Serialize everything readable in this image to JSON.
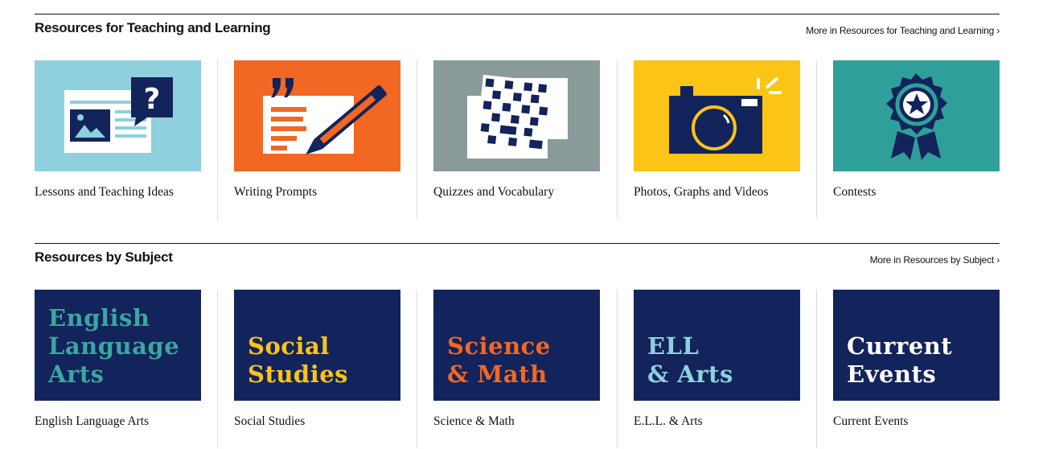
{
  "teaching": {
    "title": "Resources for Teaching and Learning",
    "more": "More in Resources for Teaching and Learning ›",
    "cards": [
      {
        "label": "Lessons and Teaching Ideas",
        "icon": "lesson-document-icon",
        "bg": "#8ed0dd"
      },
      {
        "label": "Writing Prompts",
        "icon": "writing-pencil-icon",
        "bg": "#f26722"
      },
      {
        "label": "Quizzes and Vocabulary",
        "icon": "crossword-icon",
        "bg": "#8a9a9a"
      },
      {
        "label": "Photos, Graphs and Videos",
        "icon": "camera-icon",
        "bg": "#fbc416"
      },
      {
        "label": "Contests",
        "icon": "award-ribbon-icon",
        "bg": "#2f9f9a"
      }
    ]
  },
  "subjects": {
    "title": "Resources by Subject",
    "more": "More in Resources by Subject ›",
    "cards": [
      {
        "label": "English Language Arts",
        "art_lines": [
          "English",
          "Language",
          "Arts"
        ],
        "text_color": "#3aa7a0",
        "bg": "#13235b"
      },
      {
        "label": "Social Studies",
        "art_lines": [
          "Social",
          "Studies"
        ],
        "text_color": "#fbc416",
        "bg": "#13235b"
      },
      {
        "label": "Science & Math",
        "art_lines": [
          "Science",
          "& Math"
        ],
        "text_color": "#f26722",
        "bg": "#13235b"
      },
      {
        "label": "E.L.L. & Arts",
        "art_lines": [
          "ELL",
          "& Arts"
        ],
        "text_color": "#8ed0dd",
        "bg": "#13235b"
      },
      {
        "label": "Current Events",
        "art_lines": [
          "Current",
          "Events"
        ],
        "text_color": "#ffffff",
        "bg": "#13235b"
      }
    ]
  }
}
